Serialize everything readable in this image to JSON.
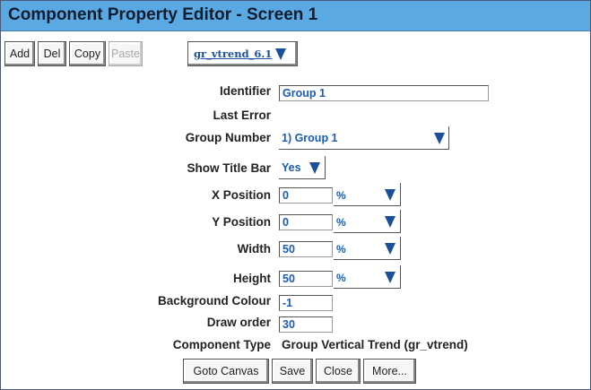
{
  "window": {
    "title": "Component Property Editor - Screen 1"
  },
  "toolbar": {
    "add": "Add",
    "del": "Del",
    "copy": "Copy",
    "paste": "Paste",
    "component_selector": "gr_vtrend_6.1"
  },
  "fields": {
    "identifier": {
      "label": "Identifier",
      "value": "Group 1"
    },
    "last_error": {
      "label": "Last Error",
      "value": ""
    },
    "group_number": {
      "label": "Group Number",
      "value": "1) Group 1"
    },
    "show_title_bar": {
      "label": "Show Title Bar",
      "value": "Yes"
    },
    "x_position": {
      "label": "X Position",
      "value": "0",
      "unit": "%"
    },
    "y_position": {
      "label": "Y Position",
      "value": "0",
      "unit": "%"
    },
    "width": {
      "label": "Width",
      "value": "50",
      "unit": "%"
    },
    "height": {
      "label": "Height",
      "value": "50",
      "unit": "%"
    },
    "background_colour": {
      "label": "Background Colour",
      "value": "-1"
    },
    "draw_order": {
      "label": "Draw order",
      "value": "30"
    },
    "component_type": {
      "label": "Component Type",
      "value": "Group Vertical Trend (gr_vtrend)"
    }
  },
  "footer": {
    "goto_canvas": "Goto Canvas",
    "save": "Save",
    "close": "Close",
    "more": "More..."
  },
  "colors": {
    "titlebar": "#5aa9e3",
    "value_text": "#1a5bb8",
    "arrow": "#1a4f9c"
  },
  "icons": {
    "dropdown": "triangle-down-icon"
  }
}
